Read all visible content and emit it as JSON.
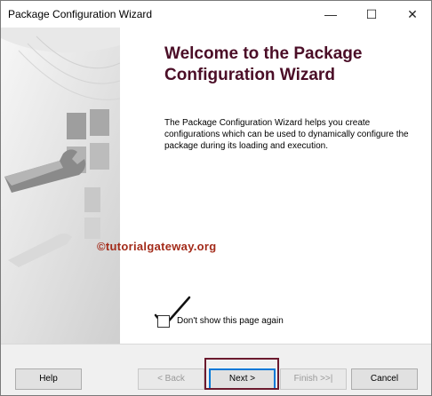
{
  "window": {
    "title": "Package Configuration Wizard",
    "controls": {
      "minimize": "—",
      "maximize": "☐",
      "close": "✕"
    }
  },
  "heading": "Welcome to the Package Configuration Wizard",
  "description": "The Package Configuration Wizard helps you create configurations which can be used to dynamically configure the package during its loading and execution.",
  "watermark": "©tutorialgateway.org",
  "checkbox": {
    "label": "Don't show this page again",
    "checked": false
  },
  "buttons": {
    "help": "Help",
    "back": "< Back",
    "next": "Next >",
    "finish": "Finish >>|",
    "cancel": "Cancel"
  },
  "colors": {
    "heading": "#4b0e27",
    "highlight": "#6b1a2e",
    "watermark": "#a32b1a"
  }
}
